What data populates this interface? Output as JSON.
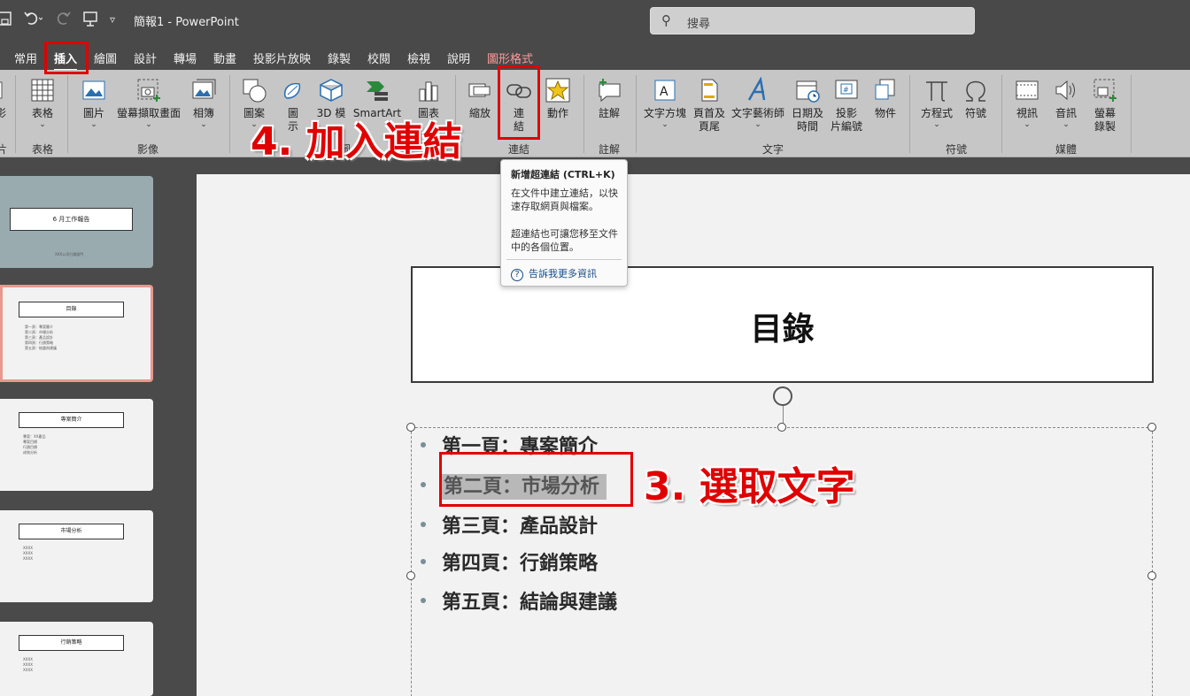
{
  "titlebar": {
    "save_icon": "save-icon",
    "undo_icon": "undo-icon",
    "redo_icon": "redo-icon",
    "present_icon": "present-icon",
    "customize_icon": "customize-icon",
    "title": "簡報1 - PowerPoint",
    "search_placeholder": "搜尋"
  },
  "tabs": [
    {
      "label": "常用"
    },
    {
      "label": "插入"
    },
    {
      "label": "繪圖"
    },
    {
      "label": "設計"
    },
    {
      "label": "轉場"
    },
    {
      "label": "動畫"
    },
    {
      "label": "投影片放映"
    },
    {
      "label": "錄製"
    },
    {
      "label": "校閱"
    },
    {
      "label": "檢視"
    },
    {
      "label": "說明"
    },
    {
      "label": "圖形格式"
    }
  ],
  "ribbon": {
    "partial_left": {
      "l1": "影",
      "l2": "片"
    },
    "table": {
      "label": "表格",
      "group": "表格"
    },
    "picture": {
      "label": "圖片"
    },
    "screenshot": {
      "label": "螢幕擷取畫面"
    },
    "album": {
      "label": "相簿"
    },
    "images_group": "影像",
    "shapes": {
      "label": "圖案"
    },
    "icons": {
      "l1": "圖",
      "l2": "示"
    },
    "model3d": {
      "label": "3D 模"
    },
    "smartart": {
      "label": "SmartArt"
    },
    "chart": {
      "label": "圖表"
    },
    "illus_group": "圖",
    "zoom": {
      "label": "縮放"
    },
    "link": {
      "l1": "連",
      "l2": "結"
    },
    "action": {
      "label": "動作"
    },
    "links_group": "連結",
    "comment": {
      "label": "註解"
    },
    "comments_group": "註解",
    "textbox": {
      "label": "文字方塊"
    },
    "headerfooter": {
      "l1": "頁首及",
      "l2": "頁尾"
    },
    "wordart": {
      "label": "文字藝術師"
    },
    "datetime": {
      "l1": "日期及",
      "l2": "時間"
    },
    "slidenum": {
      "l1": "投影",
      "l2": "片編號"
    },
    "object": {
      "label": "物件"
    },
    "text_group": "文字",
    "equation": {
      "label": "方程式"
    },
    "symbol": {
      "label": "符號"
    },
    "symbols_group": "符號",
    "video": {
      "label": "視訊"
    },
    "audio": {
      "label": "音訊"
    },
    "screenrec": {
      "l1": "螢幕",
      "l2": "錄製"
    },
    "media_group": "媒體"
  },
  "tooltip": {
    "title": "新增超連結 (CTRL+K)",
    "p1": "在文件中建立連結，以快速存取網頁與檔案。",
    "p2": "超連結也可讓您移至文件中的各個位置。",
    "more": "告訴我更多資訊"
  },
  "thumbnails": [
    {
      "title": "6 月工作報告",
      "lines": [
        "XXX公司行銷部門"
      ]
    },
    {
      "title": "目錄",
      "lines": [
        "第一頁：專案簡介",
        "第二頁：市場分析",
        "第三頁：產品設計",
        "第四頁：行銷策略",
        "第五頁：結論與建議"
      ]
    },
    {
      "title": "專案簡介",
      "lines": [
        "專案：XX產品",
        "專案目標",
        "行銷目標",
        "成效分析"
      ]
    },
    {
      "title": "市場分析",
      "lines": [
        "XXXX",
        "XXXX",
        "XXXX"
      ]
    },
    {
      "title": "行銷策略",
      "lines": [
        "XXXX",
        "XXXX",
        "XXXX"
      ]
    }
  ],
  "slide": {
    "title": "目錄",
    "items": [
      "第一頁：專案簡介",
      "第二頁：市場分析",
      "第三頁：產品設計",
      "第四頁：行銷策略",
      "第五頁：結論與建議"
    ]
  },
  "annotations": {
    "step4": "4. 加入連結",
    "step3": "3. 選取文字",
    "color": "#e00000"
  }
}
